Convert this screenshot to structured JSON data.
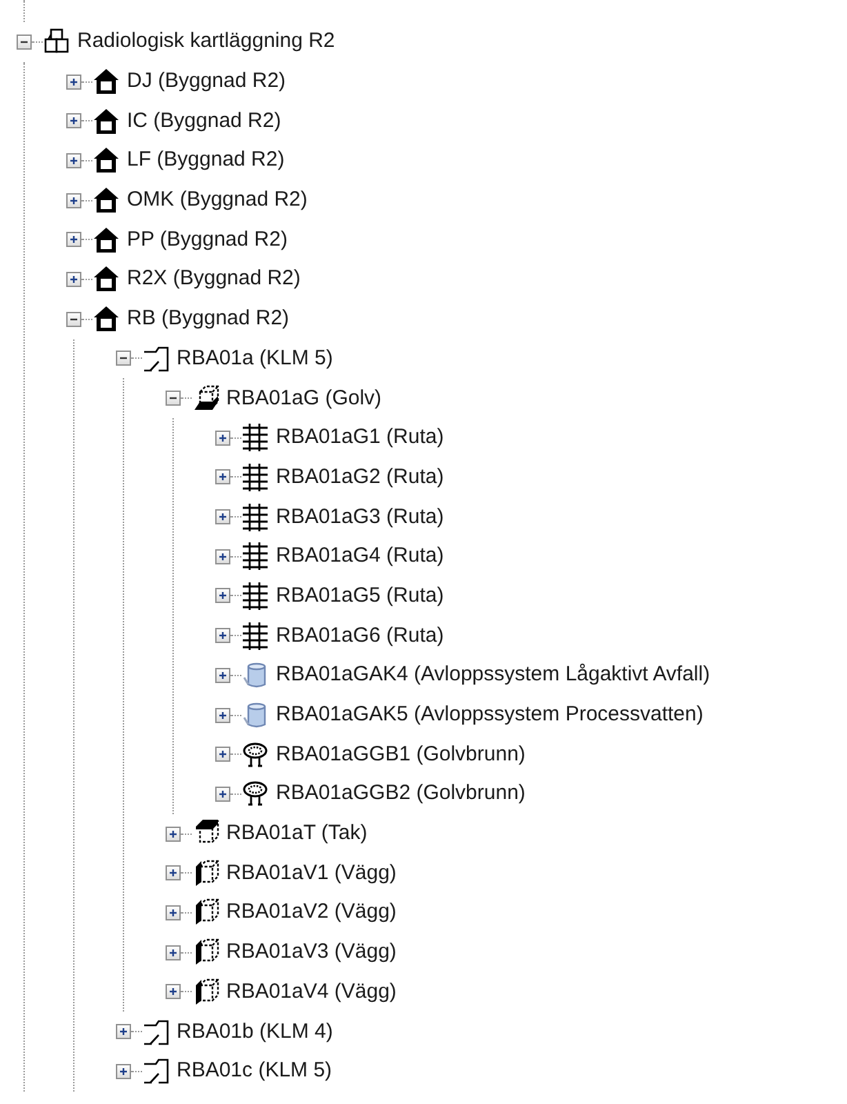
{
  "tree": [
    {
      "label": "Radiologisk kartläggning R2",
      "kind": "site",
      "expanded": true,
      "children": [
        {
          "label": "DJ (Byggnad R2)",
          "kind": "building",
          "expanded": false
        },
        {
          "label": "IC (Byggnad R2)",
          "kind": "building",
          "expanded": false
        },
        {
          "label": "LF (Byggnad R2)",
          "kind": "building",
          "expanded": false
        },
        {
          "label": "OMK (Byggnad R2)",
          "kind": "building",
          "expanded": false
        },
        {
          "label": "PP (Byggnad R2)",
          "kind": "building",
          "expanded": false
        },
        {
          "label": "R2X (Byggnad R2)",
          "kind": "building",
          "expanded": false
        },
        {
          "label": "RB (Byggnad R2)",
          "kind": "building",
          "expanded": true,
          "children": [
            {
              "label": "RBA01a (KLM 5)",
              "kind": "room",
              "expanded": true,
              "children": [
                {
                  "label": "RBA01aG (Golv)",
                  "kind": "floor",
                  "expanded": true,
                  "children": [
                    {
                      "label": "RBA01aG1 (Ruta)",
                      "kind": "grid",
                      "expanded": false
                    },
                    {
                      "label": "RBA01aG2 (Ruta)",
                      "kind": "grid",
                      "expanded": false
                    },
                    {
                      "label": "RBA01aG3 (Ruta)",
                      "kind": "grid",
                      "expanded": false
                    },
                    {
                      "label": "RBA01aG4 (Ruta)",
                      "kind": "grid",
                      "expanded": false
                    },
                    {
                      "label": "RBA01aG5 (Ruta)",
                      "kind": "grid",
                      "expanded": false
                    },
                    {
                      "label": "RBA01aG6 (Ruta)",
                      "kind": "grid",
                      "expanded": false
                    },
                    {
                      "label": "RBA01aGAK4 (Avloppssystem Lågaktivt Avfall)",
                      "kind": "pipe",
                      "expanded": false
                    },
                    {
                      "label": "RBA01aGAK5 (Avloppssystem Processvatten)",
                      "kind": "pipe",
                      "expanded": false
                    },
                    {
                      "label": "RBA01aGGB1 (Golvbrunn)",
                      "kind": "drain",
                      "expanded": false
                    },
                    {
                      "label": "RBA01aGGB2 (Golvbrunn)",
                      "kind": "drain",
                      "expanded": false
                    }
                  ]
                },
                {
                  "label": "RBA01aT (Tak)",
                  "kind": "ceiling",
                  "expanded": false
                },
                {
                  "label": "RBA01aV1 (Vägg)",
                  "kind": "wall",
                  "expanded": false
                },
                {
                  "label": "RBA01aV2 (Vägg)",
                  "kind": "wall",
                  "expanded": false
                },
                {
                  "label": "RBA01aV3 (Vägg)",
                  "kind": "wall",
                  "expanded": false
                },
                {
                  "label": "RBA01aV4 (Vägg)",
                  "kind": "wall",
                  "expanded": false
                }
              ]
            },
            {
              "label": "RBA01b (KLM 4)",
              "kind": "room",
              "expanded": false
            },
            {
              "label": "RBA01c (KLM 5)",
              "kind": "room",
              "expanded": false
            }
          ]
        }
      ]
    }
  ]
}
